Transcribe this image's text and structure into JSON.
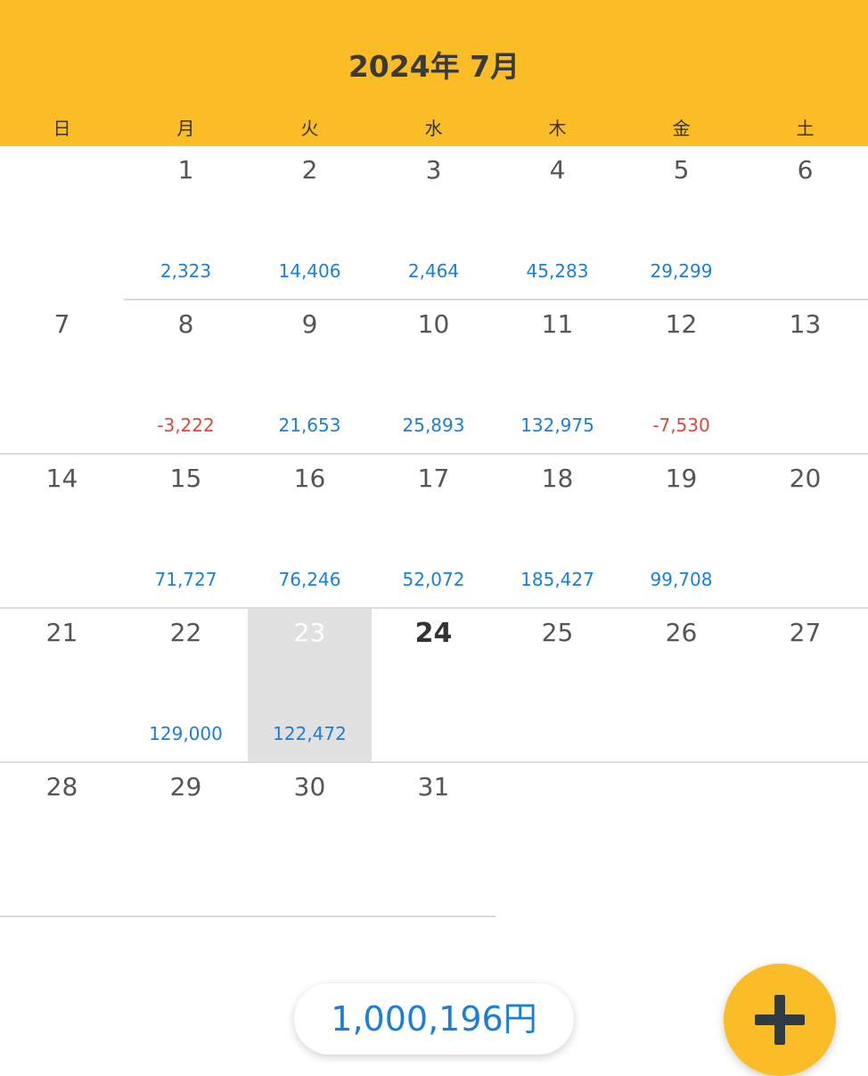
{
  "header": {
    "title": "2024年 7月",
    "background_color": "#FBBD25"
  },
  "weekdays": [
    "日",
    "月",
    "火",
    "水",
    "木",
    "金",
    "土"
  ],
  "calendar": {
    "selected_day": 23,
    "today_day": 24,
    "weeks": [
      [
        {
          "day": "",
          "amount": ""
        },
        {
          "day": "1",
          "amount": "2,323",
          "negative": false
        },
        {
          "day": "2",
          "amount": "14,406",
          "negative": false
        },
        {
          "day": "3",
          "amount": "2,464",
          "negative": false
        },
        {
          "day": "4",
          "amount": "45,283",
          "negative": false
        },
        {
          "day": "5",
          "amount": "29,299",
          "negative": false
        },
        {
          "day": "6",
          "amount": ""
        }
      ],
      [
        {
          "day": "7",
          "amount": ""
        },
        {
          "day": "8",
          "amount": "-3,222",
          "negative": true
        },
        {
          "day": "9",
          "amount": "21,653",
          "negative": false
        },
        {
          "day": "10",
          "amount": "25,893",
          "negative": false
        },
        {
          "day": "11",
          "amount": "132,975",
          "negative": false
        },
        {
          "day": "12",
          "amount": "-7,530",
          "negative": true
        },
        {
          "day": "13",
          "amount": ""
        }
      ],
      [
        {
          "day": "14",
          "amount": ""
        },
        {
          "day": "15",
          "amount": "71,727",
          "negative": false
        },
        {
          "day": "16",
          "amount": "76,246",
          "negative": false
        },
        {
          "day": "17",
          "amount": "52,072",
          "negative": false
        },
        {
          "day": "18",
          "amount": "185,427",
          "negative": false
        },
        {
          "day": "19",
          "amount": "99,708",
          "negative": false
        },
        {
          "day": "20",
          "amount": ""
        }
      ],
      [
        {
          "day": "21",
          "amount": ""
        },
        {
          "day": "22",
          "amount": "129,000",
          "negative": false
        },
        {
          "day": "23",
          "amount": "122,472",
          "negative": false
        },
        {
          "day": "24",
          "amount": ""
        },
        {
          "day": "25",
          "amount": ""
        },
        {
          "day": "26",
          "amount": ""
        },
        {
          "day": "27",
          "amount": ""
        }
      ],
      [
        {
          "day": "28",
          "amount": ""
        },
        {
          "day": "29",
          "amount": ""
        },
        {
          "day": "30",
          "amount": ""
        },
        {
          "day": "31",
          "amount": ""
        },
        {
          "day": "",
          "amount": ""
        },
        {
          "day": "",
          "amount": ""
        },
        {
          "day": "",
          "amount": ""
        }
      ]
    ]
  },
  "total": {
    "label": "1,000,196円"
  },
  "fab": {
    "icon": "plus-icon"
  },
  "colors": {
    "positive": "#1a7fd9",
    "negative": "#e0463b",
    "accent": "#FBBD25"
  }
}
